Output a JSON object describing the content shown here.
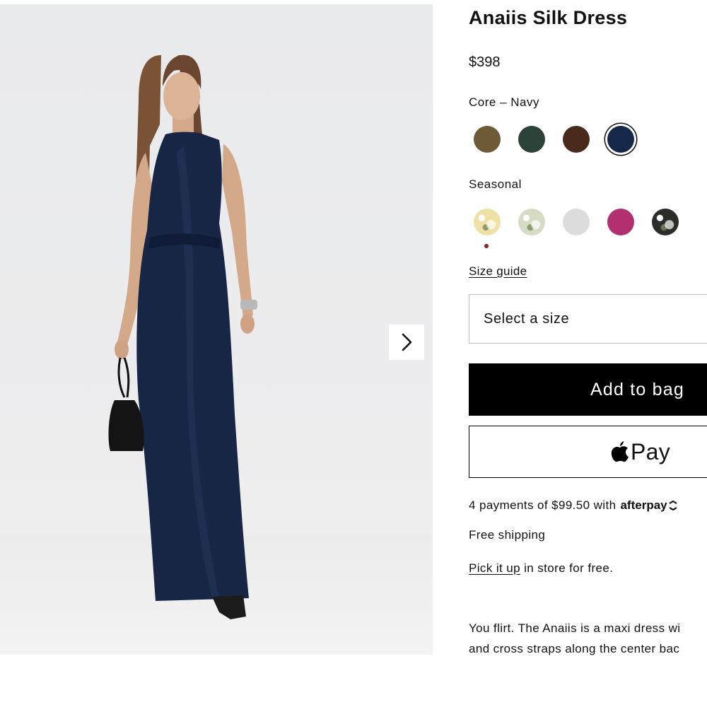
{
  "product": {
    "title": "Anaiis Silk Dress",
    "price": "$398"
  },
  "colors": {
    "core_label": "Core – Navy",
    "core": [
      {
        "name": "olive-brown",
        "hex": "#6e5a36"
      },
      {
        "name": "dark-green",
        "hex": "#2c4338"
      },
      {
        "name": "chocolate",
        "hex": "#4a2a1d"
      },
      {
        "name": "navy",
        "hex": "#15284a",
        "selected": true
      }
    ],
    "seasonal_label": "Seasonal",
    "seasonal": [
      {
        "name": "yellow-floral",
        "hex": "#efe1a6",
        "pattern": true
      },
      {
        "name": "sage-floral",
        "hex": "#d6dbc4",
        "pattern": true
      },
      {
        "name": "light-grey",
        "hex": "#dcdcdc"
      },
      {
        "name": "magenta",
        "hex": "#b2306f"
      },
      {
        "name": "dark-floral",
        "hex": "#2a2d28",
        "pattern": true
      }
    ]
  },
  "size": {
    "guide_label": "Size guide",
    "select_placeholder": "Select a size"
  },
  "actions": {
    "add_to_bag": "Add to bag",
    "apple_pay": "Pay"
  },
  "payment": {
    "installments_text": "4 payments of $99.50 with",
    "afterpay_brand": "afterpay"
  },
  "shipping": {
    "free_shipping": "Free shipping",
    "pickup_link": "Pick it up",
    "pickup_rest": " in store for free."
  },
  "description": {
    "line1": "You flirt. The Anaiis is a maxi dress wi",
    "line2": "and cross straps along the center bac"
  },
  "theme": {
    "accent": "#000000",
    "sale_dot": "#9b1c1c"
  }
}
